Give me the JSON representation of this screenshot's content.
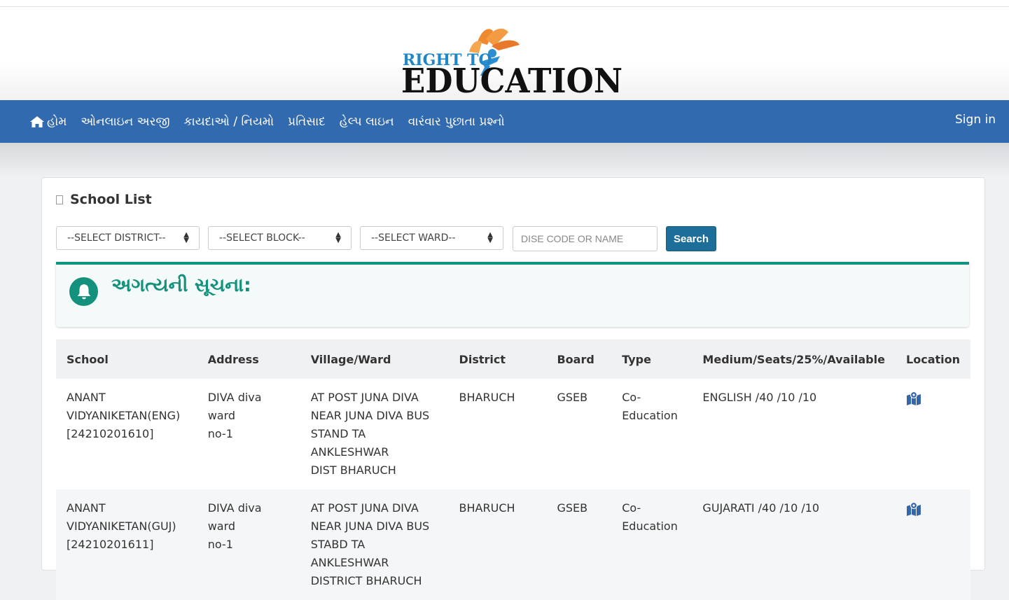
{
  "logo": {
    "line1": "RIGHT TO",
    "line2": "EDUCATION"
  },
  "nav": {
    "items": [
      {
        "label": "હોમ",
        "icon": "home-icon"
      },
      {
        "label": "ઓનલાઇન અરજી"
      },
      {
        "label": "કાયદાઓ / નિયમો"
      },
      {
        "label": "પ્રતિસાદ"
      },
      {
        "label": "હેલ્પ લાઇન"
      },
      {
        "label": "વારંવાર પુછાતા પ્રશ્નો"
      }
    ],
    "signin": "Sign in"
  },
  "card": {
    "title": "School List"
  },
  "filters": {
    "district": "--SELECT DISTRICT--",
    "block": "--SELECT BLOCK--",
    "ward": "--SELECT WARD--",
    "search_placeholder": "DISE CODE OR NAME",
    "search_label": "Search"
  },
  "notice": {
    "title": "અગત્યની સૂચના:"
  },
  "table": {
    "headers": [
      "School",
      "Address",
      "Village/Ward",
      "District",
      "Board",
      "Type",
      "Medium/Seats/25%/Available",
      "Location"
    ],
    "rows": [
      {
        "school_line1": "ANANT",
        "school_line2": "VIDYANIKETAN(ENG)",
        "school_line3": "[24210201610]",
        "address_line1": "DIVA diva ward",
        "address_line2": "no-1",
        "village_line1": "AT POST JUNA DIVA",
        "village_line2": "NEAR JUNA DIVA BUS",
        "village_line3": "STAND TA ANKLESHWAR",
        "village_line4": "DIST BHARUCH",
        "district": "BHARUCH",
        "board": "GSEB",
        "type_line1": "Co-",
        "type_line2": "Education",
        "medium": "ENGLISH /40 /10 /10"
      },
      {
        "school_line1": "ANANT",
        "school_line2": "VIDYANIKETAN(GUJ)",
        "school_line3": "[24210201611]",
        "address_line1": "DIVA diva ward",
        "address_line2": "no-1",
        "village_line1": "AT POST JUNA DIVA",
        "village_line2": "NEAR JUNA DIVA BUS",
        "village_line3": "STABD TA ANKLESHWAR",
        "village_line4": "DISTRICT BHARUCH",
        "district": "BHARUCH",
        "board": "GSEB",
        "type_line1": "Co-",
        "type_line2": "Education",
        "medium": "GUJARATI /40 /10 /10"
      }
    ]
  },
  "colors": {
    "nav_bg": "#326ab0",
    "notice_accent": "#13917c",
    "search_btn": "#1d6f9a"
  }
}
